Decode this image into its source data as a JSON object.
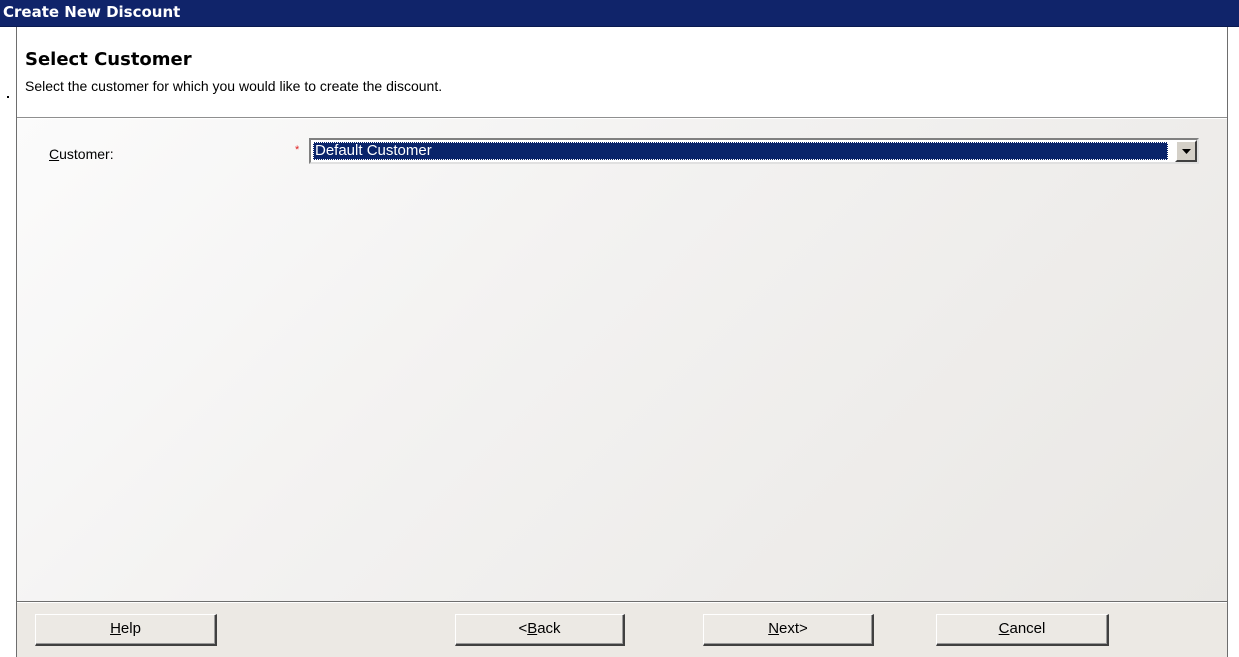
{
  "window": {
    "title": "Create New Discount"
  },
  "header": {
    "title": "Select Customer",
    "subtitle": "Select the customer for which you would like to create the discount."
  },
  "form": {
    "customer_label_accel": "C",
    "customer_label_rest": "ustomer:",
    "required_marker": "*",
    "customer_value": "Default Customer"
  },
  "buttons": {
    "help_accel": "H",
    "help_rest": "elp",
    "back_prefix": "<",
    "back_accel": "B",
    "back_rest": "ack",
    "next_accel": "N",
    "next_rest": "ext>",
    "cancel_accel": "C",
    "cancel_rest": "ancel"
  },
  "icons": {
    "combo_arrow": "chevron-down-icon"
  },
  "colors": {
    "titlebar": "#10246a",
    "selection": "#0a246a",
    "required": "#e02020"
  }
}
